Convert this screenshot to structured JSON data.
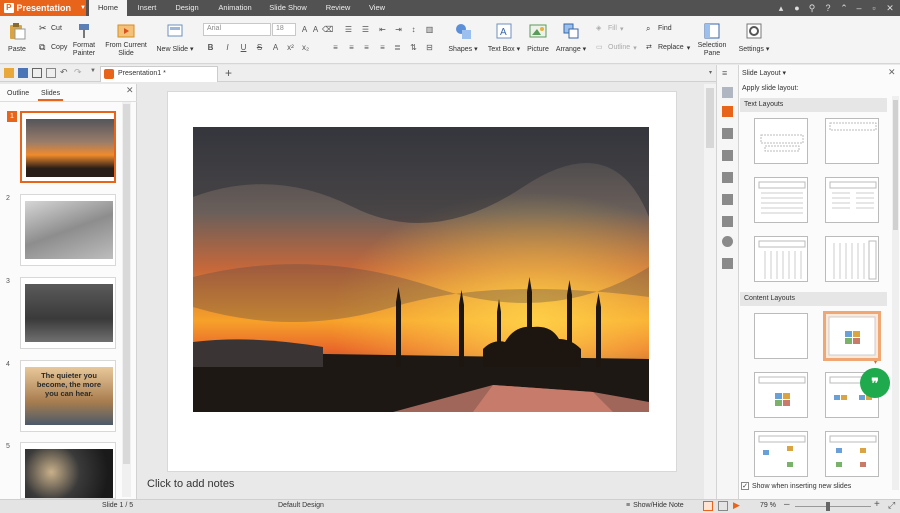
{
  "app": {
    "menu_label": "Presentation"
  },
  "menu_tabs": [
    "Home",
    "Insert",
    "Design",
    "Animation",
    "Slide Show",
    "Review",
    "View"
  ],
  "ribbon": {
    "paste": "Paste",
    "cut": "Cut",
    "copy": "Copy",
    "format_painter": [
      "Format",
      "Painter"
    ],
    "from_current_slide": [
      "From Current",
      "Slide"
    ],
    "new_slide": "New Slide",
    "font_name": "Arial",
    "font_size": "18",
    "shapes": "Shapes",
    "text_box": "Text Box",
    "picture": "Picture",
    "arrange": "Arrange",
    "fill": "Fill",
    "outline": "Outline",
    "find": "Find",
    "replace": "Replace",
    "selection_pane": [
      "Selection",
      "Pane"
    ],
    "settings": "Settings"
  },
  "document_tab": "Presentation1 *",
  "left_panel": {
    "tabs": [
      "Outline",
      "Slides"
    ],
    "active_tab": "Slides",
    "slides": [
      {
        "number": "1",
        "text": "",
        "selected": true
      },
      {
        "number": "2",
        "text": "",
        "selected": false
      },
      {
        "number": "3",
        "text": "",
        "selected": false
      },
      {
        "number": "4",
        "text": "The quieter you become, the more you can hear.",
        "selected": false
      },
      {
        "number": "5",
        "text": "",
        "selected": false
      }
    ]
  },
  "notes_placeholder": "Click to add notes",
  "right_panel": {
    "title": "Slide Layout",
    "apply_label": "Apply slide layout:",
    "sections": [
      "Text Layouts",
      "Content Layouts"
    ],
    "checkbox_label": "Show when inserting new slides",
    "checkbox_checked": true
  },
  "status": {
    "slide_indicator": "Slide 1 / 5",
    "design": "Default Design",
    "notes_toggle": "Show/Hide Note",
    "zoom": "79 %"
  },
  "colors": {
    "accent": "#e8641b",
    "titlebar": "#525252",
    "fab": "#1faa4e"
  }
}
